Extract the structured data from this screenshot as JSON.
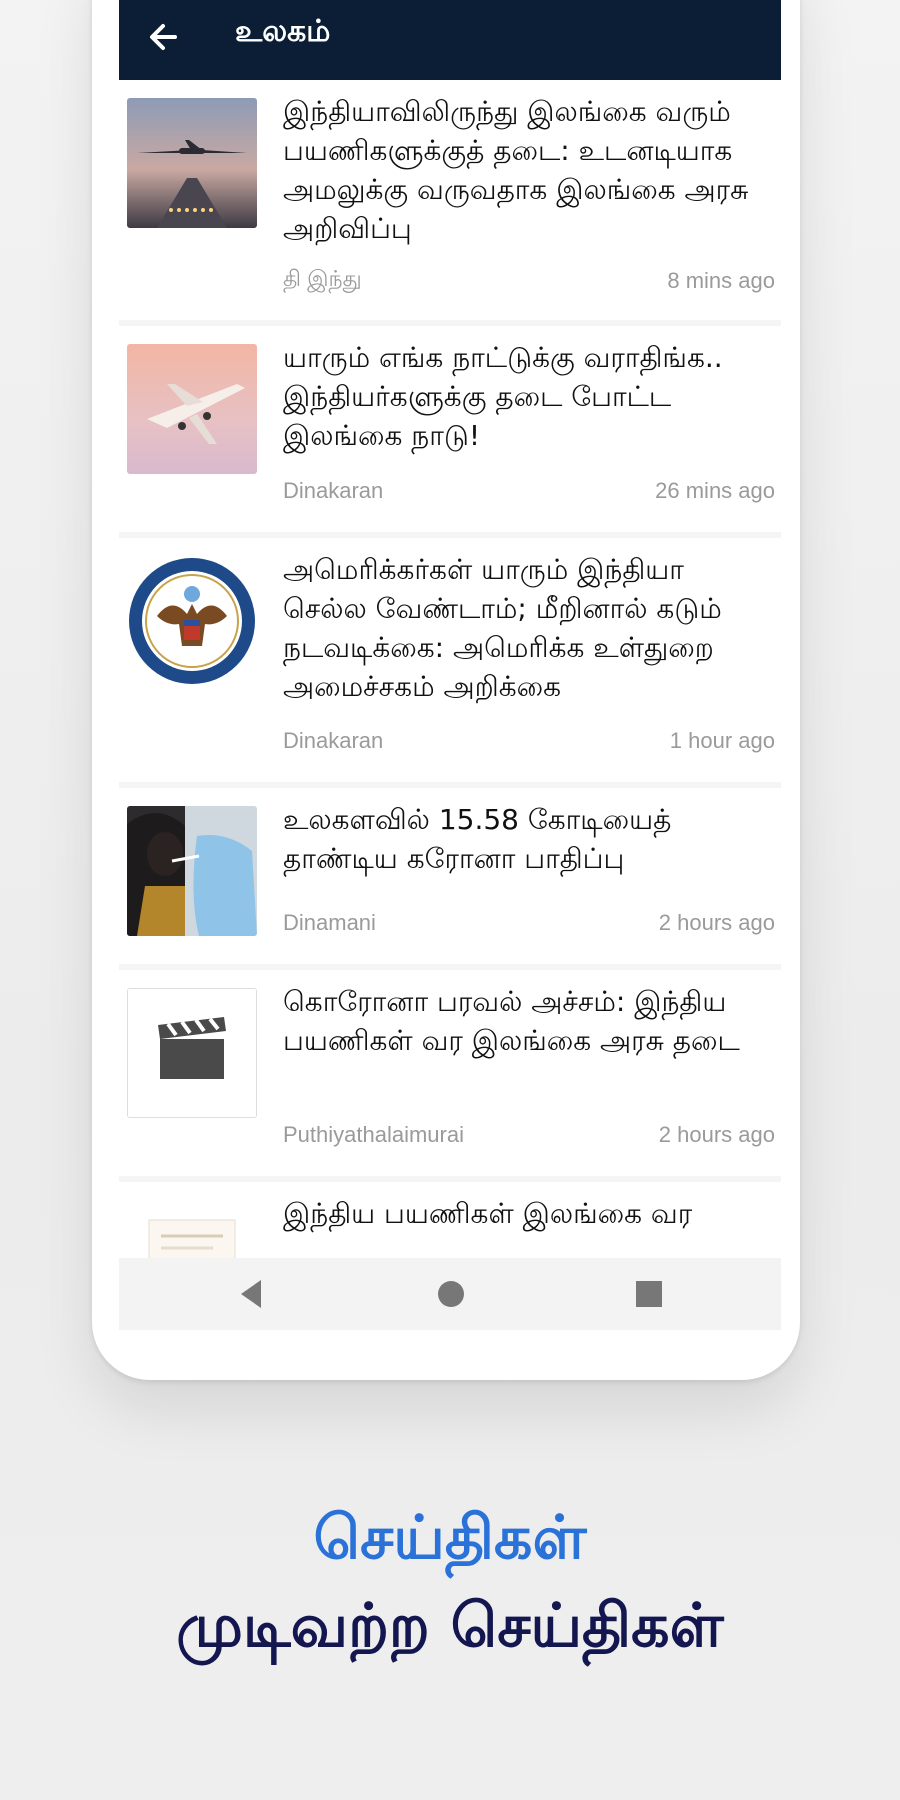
{
  "appbar": {
    "title": "உலகம்",
    "back_icon": "arrow-left-icon"
  },
  "colors": {
    "appbar_bg": "#0b1e36",
    "tagline_primary": "#2a72d8",
    "tagline_secondary": "#13164f",
    "meta_text": "#9a9a9a"
  },
  "articles": [
    {
      "headline": "இந்தியாவிலிருந்து இலங்கை வரும் பயணிகளுக்குத் தடை: உடனடியாக அமலுக்கு வருவதாக இலங்கை அரசு அறிவிப்பு",
      "source": "தி இந்து",
      "time": "8 mins ago",
      "thumb_icon": "airplane-landing-icon"
    },
    {
      "headline": "யாரும் எங்க நாட்டுக்கு வராதிங்க.. இந்தியர்களுக்கு தடை போட்ட இலங்கை நாடு!",
      "source": "Dinakaran",
      "time": "26 mins ago",
      "thumb_icon": "airplane-sunset-icon"
    },
    {
      "headline": "அமெரிக்கர்கள் யாரும் இந்தியா செல்ல வேண்டாம்; மீறினால் கடும் நடவடிக்கை: அமெரிக்க உள்துறை அமைச்சகம் அறிக்கை",
      "source": "Dinakaran",
      "time": "1 hour ago",
      "thumb_icon": "us-state-department-seal-icon"
    },
    {
      "headline": "உலகளவில் 15.58 கோடியைத் தாண்டிய கரோனா பாதிப்பு",
      "source": "Dinamani",
      "time": "2 hours ago",
      "thumb_icon": "covid-swab-test-icon"
    },
    {
      "headline": "கொரோனா பரவல் அச்சம்: இந்திய பயணிகள் வர இலங்கை அரசு தடை",
      "source": "Puthiyathalaimurai",
      "time": "2 hours ago",
      "thumb_icon": "clapperboard-icon"
    },
    {
      "headline": "இந்திய பயணிகள் இலங்கை வர",
      "source": "",
      "time": "",
      "thumb_icon": "document-icon"
    }
  ],
  "navbar": {
    "back_icon": "nav-back-icon",
    "home_icon": "nav-home-icon",
    "recents_icon": "nav-recents-icon"
  },
  "taglines": {
    "line1": "செய்திகள்",
    "line2": "முடிவற்ற செய்திகள்"
  }
}
